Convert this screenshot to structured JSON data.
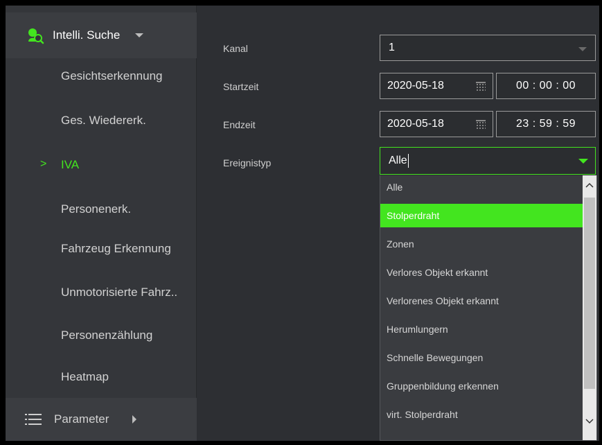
{
  "sidebar": {
    "header_label": "Intelli. Suche",
    "items": [
      {
        "label": "Gesichtserkennung",
        "active": false
      },
      {
        "label": "Ges. Wiedererk.",
        "active": false
      },
      {
        "label": "IVA",
        "active": true
      },
      {
        "label": "Personenerk.",
        "active": false
      },
      {
        "label": "Fahrzeug Erkennung",
        "active": false
      },
      {
        "label": "Unmotorisierte Fahrz..",
        "active": false
      },
      {
        "label": "Personenzählung",
        "active": false
      },
      {
        "label": "Heatmap",
        "active": false
      }
    ],
    "active_marker": ">",
    "footer_label": "Parameter"
  },
  "form": {
    "kanal_label": "Kanal",
    "kanal_value": "1",
    "start_label": "Startzeit",
    "start_date": "2020-05-18",
    "start_time": "00 : 00 : 00",
    "end_label": "Endzeit",
    "end_date": "2020-05-18",
    "end_time": "23 : 59 : 59",
    "event_label": "Ereignistyp",
    "event_value": "Alle"
  },
  "dropdown": {
    "options": [
      "Alle",
      "Stolperdraht",
      "Zonen",
      "Verlores Objekt erkannt",
      "Verlorenes Objekt erkannt",
      "Herumlungern",
      "Schnelle Bewegungen",
      "Gruppenbildung erkennen",
      "virt. Stolperdraht"
    ],
    "highlighted": "Stolperdraht"
  },
  "colors": {
    "accent": "#43e51f",
    "background": "#2d2f33",
    "sidebar": "#34363a"
  },
  "icons": {
    "header": "intelli-search-icon",
    "footer": "list-icon",
    "calendar": "calendar-icon"
  }
}
